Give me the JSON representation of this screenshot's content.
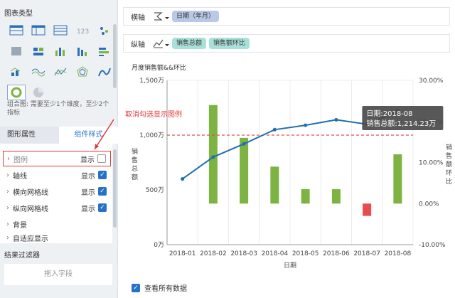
{
  "left": {
    "chart_type_title": "图表类型",
    "chart_type_icons": [
      "table-icon",
      "cross-table-icon",
      "detail-table-icon",
      "number-card-icon",
      "scatter-map-icon",
      "heat-map-icon",
      "multi-table-icon",
      "bar-chart-icon",
      "column-compare-icon",
      "stacked-bar-icon",
      "line-chart-icon",
      "radar-chart-icon",
      "ring-chart-icon",
      "combo-chart-icon",
      "scatter-chart-icon",
      "pie-breakdown-icon",
      "pie-chart-icon"
    ],
    "hint": "组合图: 需要至少1个维度，至少2个指标",
    "tab_properties": "图形属性",
    "tab_style": "组件样式",
    "rows": [
      {
        "label": "图例",
        "value": "显示",
        "checked": false
      },
      {
        "label": "轴线",
        "value": "显示",
        "checked": true
      },
      {
        "label": "横向网格线",
        "value": "显示",
        "checked": true
      },
      {
        "label": "纵向网格线",
        "value": "显示",
        "checked": true
      },
      {
        "label": "背景",
        "value": "",
        "checked": null
      },
      {
        "label": "自适应显示",
        "value": "",
        "checked": null
      }
    ],
    "filter_title": "结果过滤器",
    "drop_hint": "拖入字段"
  },
  "axes": {
    "x_label": "横轴",
    "x_pill": "日期（年月）",
    "y_label": "纵轴",
    "y_pills": [
      "销售总额",
      "销售额环比"
    ]
  },
  "annotation": "取消勾选显示图例",
  "view_all": "查看所有数据",
  "tooltip": {
    "line1": "日期:2018-08",
    "line2": "销售总额:1,214.23万"
  },
  "chart_data": {
    "type": "bar",
    "title": "月度销售额&&环比",
    "xlabel": "日期",
    "ylabel": "销售总额",
    "y2label": "销售额环比",
    "categories": [
      "2018-01",
      "2018-02",
      "2018-03",
      "2018-04",
      "2018-05",
      "2018-06",
      "2018-07",
      "2018-08"
    ],
    "y_ticks": [
      "0万",
      "500万",
      "1,000万",
      "1,500万"
    ],
    "ylim": [
      0,
      1500
    ],
    "y2_ticks": [
      "-10.00%",
      "0.00%",
      "10.00%",
      "20.00%",
      "30.00%"
    ],
    "y2lim": [
      -10,
      30
    ],
    "series": [
      {
        "name": "销售额环比",
        "type": "bar",
        "values": [
          0,
          24,
          16,
          9,
          3.5,
          3.5,
          -3,
          12
        ]
      },
      {
        "name": "销售总额",
        "type": "line",
        "values": [
          600,
          800,
          920,
          1050,
          1090,
          1140,
          1100,
          1214
        ]
      }
    ],
    "reference_line": 1000,
    "colors": {
      "bar_pos": "#7cb342",
      "bar_neg": "#e84c4c",
      "line": "#1f6fb2",
      "ref": "#e84c4c"
    },
    "grid": true,
    "legend": "none"
  }
}
